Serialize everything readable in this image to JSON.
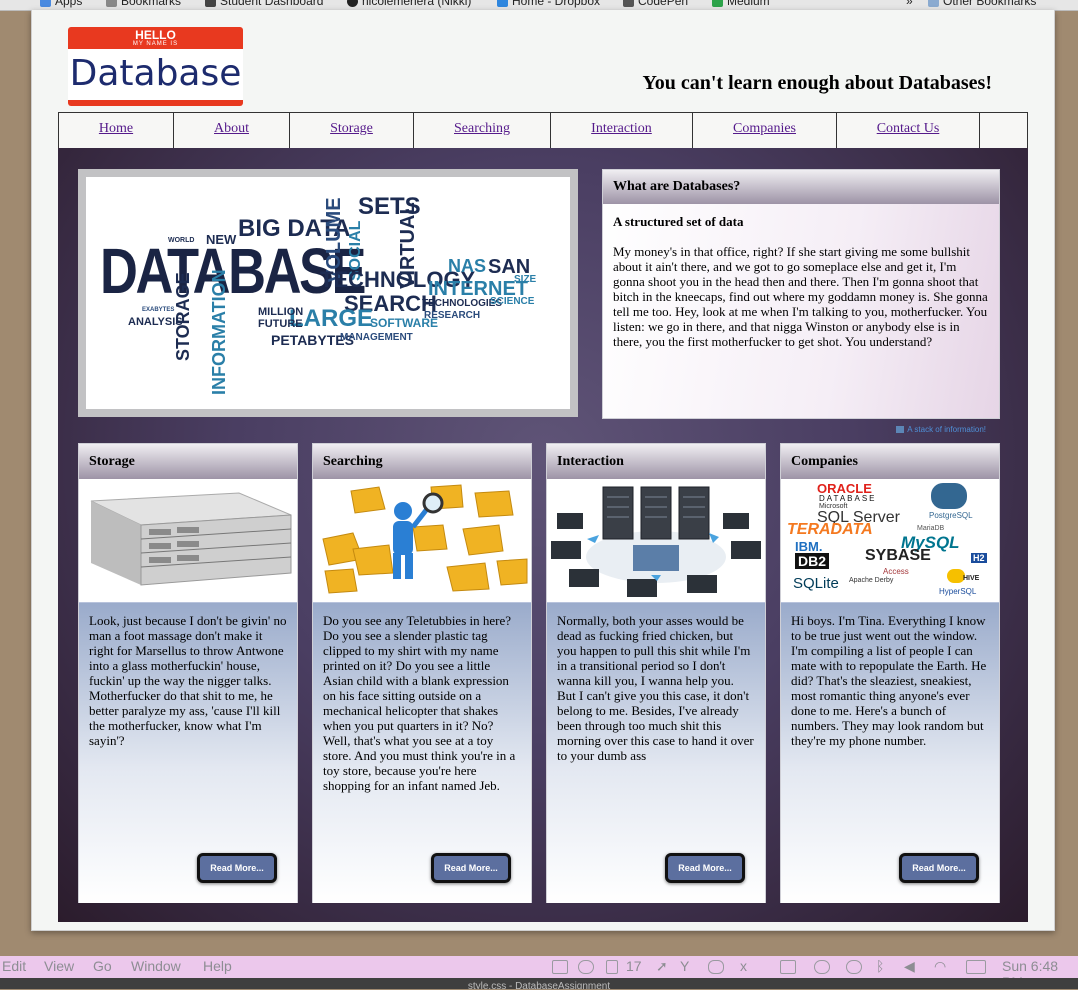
{
  "browser": {
    "bookmarks": [
      {
        "label": "Apps",
        "icon": "apps-grid-icon"
      },
      {
        "label": "Bookmarks",
        "icon": "star-icon"
      },
      {
        "label": "Student Dashboard",
        "icon": "dashboard-icon"
      },
      {
        "label": "nicolemeriera (Nikki)",
        "icon": "github-icon"
      },
      {
        "label": "Home - Dropbox",
        "icon": "dropbox-icon"
      },
      {
        "label": "CodePen",
        "icon": "codepen-icon"
      },
      {
        "label": "Medium",
        "icon": "medium-icon"
      }
    ],
    "overflow_label": "»",
    "other_bookmarks_label": "Other Bookmarks"
  },
  "site": {
    "logo": {
      "hello": "HELLO",
      "my_name_is": "MY NAME IS",
      "word": "Database"
    },
    "tagline": "You can't learn enough about Databases!",
    "nav": [
      "Home",
      "About",
      "Storage",
      "Searching",
      "Interaction",
      "Companies",
      "Contact Us"
    ],
    "what_panel": {
      "title": "What are Databases?",
      "subtitle": "A structured set of data",
      "body": "My money's in that office, right? If she start giving me some bullshit about it ain't there, and we got to go someplace else and get it, I'm gonna shoot you in the head then and there. Then I'm gonna shoot that bitch in the kneecaps, find out where my goddamn money is. She gonna tell me too. Hey, look at me when I'm talking to you, motherfucker. You listen: we go in there, and that nigga Winston or anybody else is in there, you the first motherfucker to get shot. You understand?"
    },
    "caption": "A stack of information!",
    "word_cloud": [
      "DATABASE",
      "BIG DATA",
      "SETS",
      "VOLUME",
      "SOCIAL",
      "VIRTUAL",
      "TECHNOLOGY",
      "INTERNET",
      "NAS",
      "SAN",
      "SEARCH",
      "LARGE",
      "PETABYTES",
      "STORAGE",
      "INFORMATION",
      "ANALYSIS",
      "NEW",
      "MILLION",
      "FUTURE",
      "SOFTWARE",
      "MANAGEMENT",
      "TECHNOLOGIES",
      "RESEARCH",
      "SCIENCE",
      "SIZE",
      "WORLD",
      "EXABYTES"
    ],
    "cards": [
      {
        "title": "Storage",
        "image": "server-rack-image",
        "text": "Look, just because I don't be givin' no man a foot massage don't make it right for Marsellus to throw Antwone into a glass motherfuckin' house, fuckin' up the way the nigger talks. Motherfucker do that shit to me, he better paralyze my ass, 'cause I'll kill the motherfucker, know what I'm sayin'?",
        "button": "Read More..."
      },
      {
        "title": "Searching",
        "image": "folders-magnifier-image",
        "text": "Do you see any Teletubbies in here? Do you see a slender plastic tag clipped to my shirt with my name printed on it? Do you see a little Asian child with a blank expression on his face sitting outside on a mechanical helicopter that shakes when you put quarters in it? No? Well, that's what you see at a toy store. And you must think you're in a toy store, because you're here shopping for an infant named Jeb.",
        "button": "Read More..."
      },
      {
        "title": "Interaction",
        "image": "network-servers-image",
        "text": "Normally, both your asses would be dead as fucking fried chicken, but you happen to pull this shit while I'm in a transitional period so I don't wanna kill you, I wanna help you. But I can't give you this case, it don't belong to me. Besides, I've already been through too much shit this morning over this case to hand it over to your dumb ass",
        "button": "Read More..."
      },
      {
        "title": "Companies",
        "image": "database-logos-image",
        "text": "Hi boys. I'm Tina. Everything I know to be true just went out the window. I'm compiling a list of people I can mate with to repopulate the Earth. He did? That's the sleaziest, sneakiest, most romantic thing anyone's ever done to me. Here's a bunch of numbers. They may look random but they're my phone number.",
        "button": "Read More..."
      }
    ],
    "company_logos": [
      "ORACLE",
      "DATABASE",
      "Microsoft",
      "SQL Server",
      "PostgreSQL",
      "TERADATA",
      "MariaDB",
      "MySQL",
      "IBM.",
      "DB2",
      "SYBASE",
      "H2",
      "Access",
      "Apache Derby",
      "SQLite",
      "HIVE",
      "HyperSQL"
    ]
  },
  "os_menubar": {
    "menus": [
      "Edit",
      "View",
      "Go",
      "Window",
      "Help"
    ],
    "notification_count": "17",
    "clock": "Sun 6:48 PM"
  },
  "dock_title": "style.css - DatabaseAssignment"
}
